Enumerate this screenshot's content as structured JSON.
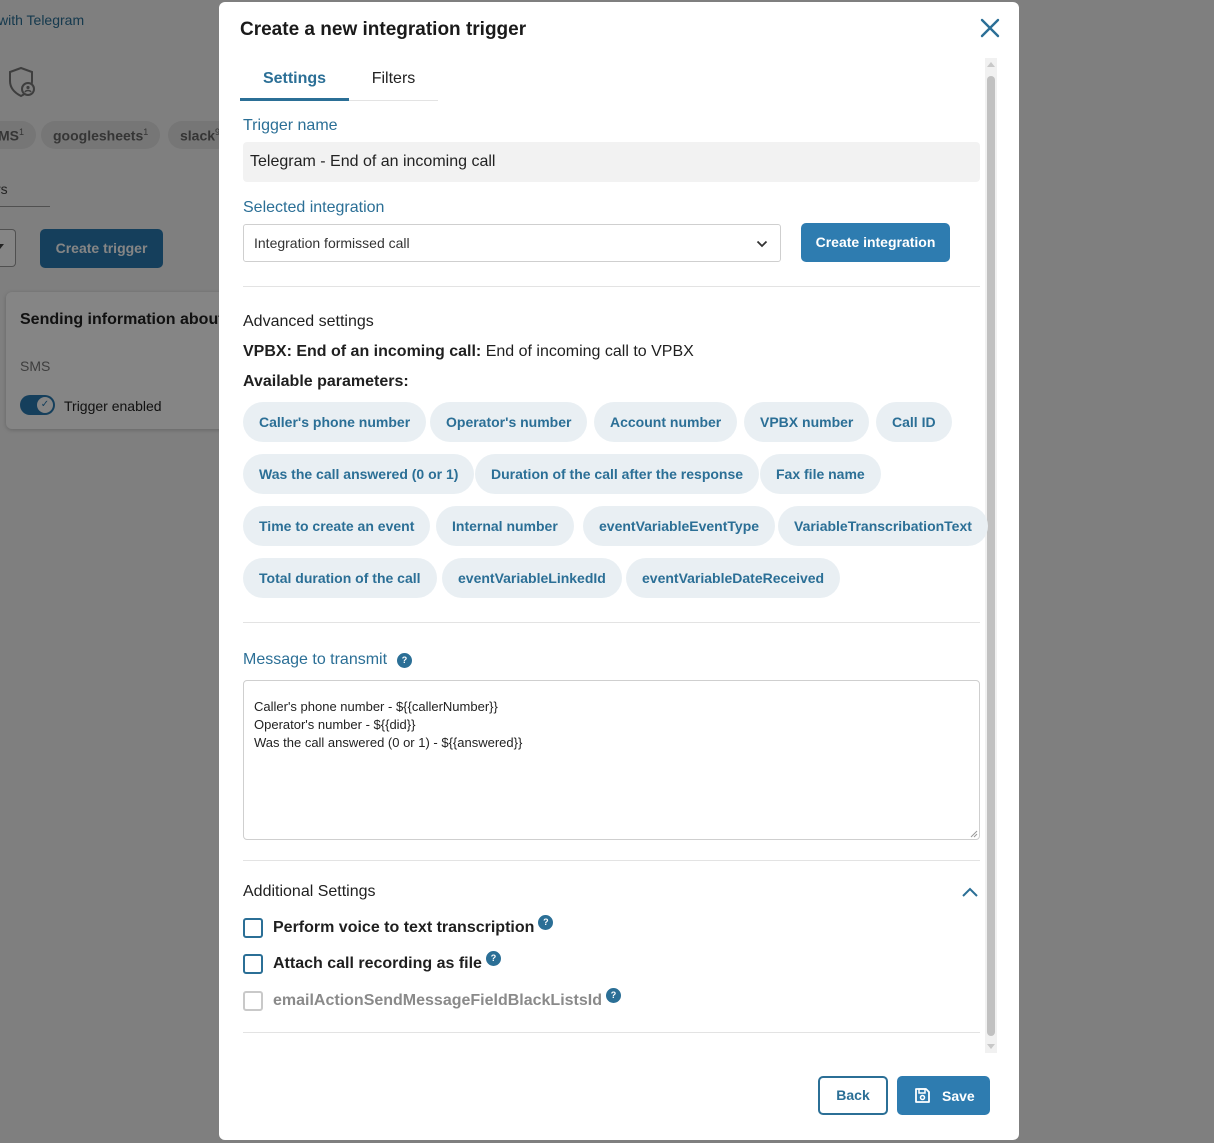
{
  "background": {
    "link_text": "with Telegram",
    "chips": [
      {
        "label": "MS",
        "count": "1"
      },
      {
        "label": "googlesheets",
        "count": "1"
      },
      {
        "label": "slack",
        "count": "9"
      }
    ],
    "tab_label": "rs",
    "create_trigger_label": "Create trigger",
    "card": {
      "title": "Sending information about",
      "subtitle": "SMS",
      "toggle_label": "Trigger enabled"
    }
  },
  "modal": {
    "title": "Create a new integration trigger",
    "tabs": [
      {
        "label": "Settings",
        "active": true
      },
      {
        "label": "Filters",
        "active": false
      }
    ],
    "trigger_name_label": "Trigger name",
    "trigger_name_value": "Telegram - End of an incoming call",
    "selected_integration_label": "Selected integration",
    "selected_integration_value": "Integration formissed call",
    "create_integration_label": "Create integration",
    "advanced_settings_label": "Advanced settings",
    "event_bold": "VPBX: End of an incoming call:",
    "event_text": " End of incoming call to VPBX",
    "available_parameters_label": "Available parameters:",
    "parameters": [
      "Caller's phone number",
      "Operator's number",
      "Account number",
      "VPBX number",
      "Call ID",
      "Was the call answered (0 or 1)",
      "Duration of the call after the response",
      "Fax file name",
      "Time to create an event",
      "Internal number",
      "eventVariableEventType",
      "VariableTranscribationText",
      "Total duration of the call",
      "eventVariableLinkedId",
      "eventVariableDateReceived"
    ],
    "message_label": "Message to transmit",
    "message_lines": [
      "Caller's phone number - ${{callerNumber}}",
      "Operator's number - ${{did}}",
      "Was the call answered (0 or 1) - ${{answered}}"
    ],
    "additional_settings_label": "Additional Settings",
    "checkboxes": [
      {
        "label": "Perform voice to text transcription",
        "checked": false,
        "disabled": false
      },
      {
        "label": "Attach call recording as file",
        "checked": false,
        "disabled": false
      },
      {
        "label": "emailActionSendMessageFieldBlackListsId",
        "checked": false,
        "disabled": true
      }
    ],
    "help_glyph": "?",
    "back_label": "Back",
    "save_label": "Save"
  },
  "colors": {
    "accent": "#2b6f96",
    "button": "#2e7cb0",
    "chip_bg": "#e9eff3"
  }
}
